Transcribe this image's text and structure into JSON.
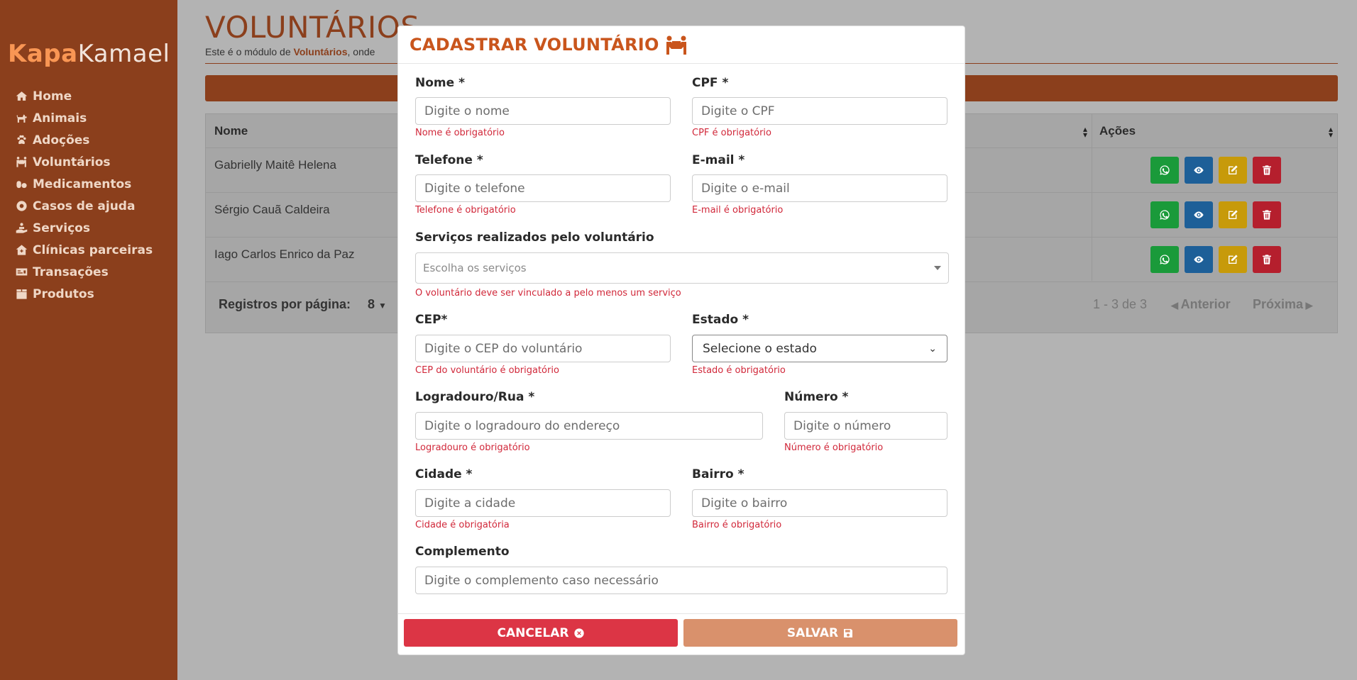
{
  "brand": {
    "part1": "Kapa",
    "part2": "Kamael"
  },
  "sidebar": {
    "items": [
      {
        "label": "Home",
        "icon": "home-icon"
      },
      {
        "label": "Animais",
        "icon": "dog-icon"
      },
      {
        "label": "Adoções",
        "icon": "paw-icon"
      },
      {
        "label": "Voluntários",
        "icon": "people-carry-icon"
      },
      {
        "label": "Medicamentos",
        "icon": "pills-icon"
      },
      {
        "label": "Casos de ajuda",
        "icon": "life-ring-icon"
      },
      {
        "label": "Serviços",
        "icon": "hand-holding-icon"
      },
      {
        "label": "Clínicas parceiras",
        "icon": "clinic-icon"
      },
      {
        "label": "Transações",
        "icon": "money-check-icon"
      },
      {
        "label": "Produtos",
        "icon": "box-icon"
      }
    ]
  },
  "page": {
    "title": "VOLUNTÁRIOS",
    "subtitle_pre": "Este é o módulo de ",
    "subtitle_bold": "Voluntários",
    "subtitle_post": ", onde"
  },
  "table": {
    "headers": {
      "name": "Nome",
      "actions": "Ações"
    },
    "rows": [
      {
        "name": "Gabrielly Maitê Helena"
      },
      {
        "name": "Sérgio Cauã Caldeira"
      },
      {
        "name": "Iago Carlos Enrico da Paz"
      }
    ],
    "rows_per_page_label": "Registros por página:",
    "rows_per_page_value": "8",
    "range": "1 - 3 de 3",
    "prev": "Anterior",
    "next": "Próxima"
  },
  "modal": {
    "title": "CADASTRAR VOLUNTÁRIO",
    "fields": {
      "nome": {
        "label": "Nome *",
        "placeholder": "Digite o nome",
        "error": "Nome é obrigatório"
      },
      "cpf": {
        "label": "CPF *",
        "placeholder": "Digite o CPF",
        "error": "CPF é obrigatório"
      },
      "telefone": {
        "label": "Telefone *",
        "placeholder": "Digite o telefone",
        "error": "Telefone é obrigatório"
      },
      "email": {
        "label": "E-mail *",
        "placeholder": "Digite o e-mail",
        "error": "E-mail é obrigatório"
      },
      "servicos": {
        "label": "Serviços realizados pelo voluntário",
        "placeholder": "Escolha os serviços",
        "error": "O voluntário deve ser vinculado a pelo menos um serviço"
      },
      "cep": {
        "label": "CEP*",
        "placeholder": "Digite o CEP do voluntário",
        "error": "CEP do voluntário é obrigatório"
      },
      "estado": {
        "label": "Estado *",
        "value": "Selecione o estado",
        "error": "Estado é obrigatório"
      },
      "logradouro": {
        "label": "Logradouro/Rua *",
        "placeholder": "Digite o logradouro do endereço",
        "error": "Logradouro é obrigatório"
      },
      "numero": {
        "label": "Número *",
        "placeholder": "Digite o número",
        "error": "Número é obrigatório"
      },
      "cidade": {
        "label": "Cidade *",
        "placeholder": "Digite a cidade",
        "error": "Cidade é obrigatória"
      },
      "bairro": {
        "label": "Bairro *",
        "placeholder": "Digite o bairro",
        "error": "Bairro é obrigatório"
      },
      "complemento": {
        "label": "Complemento",
        "placeholder": "Digite o complemento caso necessário"
      }
    },
    "buttons": {
      "cancel": "CANCELAR",
      "save": "SALVAR"
    }
  },
  "colors": {
    "sidebar": "#8b3f1c",
    "accent": "#c9551c",
    "error": "#d1283a",
    "cancel": "#dc3545",
    "save": "#d9916c"
  }
}
